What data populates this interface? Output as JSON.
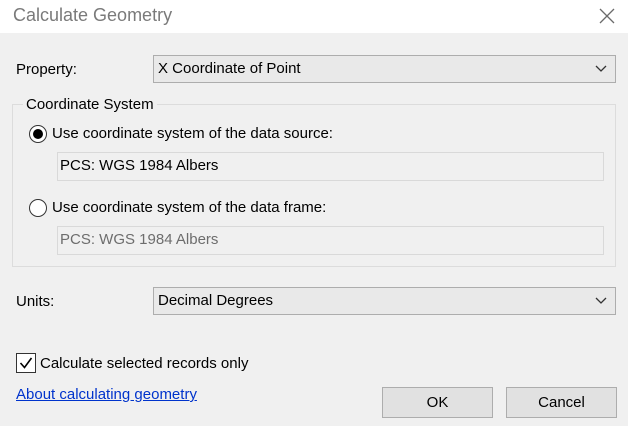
{
  "window": {
    "title": "Calculate Geometry"
  },
  "property": {
    "label": "Property:",
    "value": "X Coordinate of Point"
  },
  "coordinate_system": {
    "group_label": "Coordinate System",
    "option_source": {
      "label": "Use coordinate system of the data source:",
      "selected": true,
      "value": "PCS: WGS 1984 Albers"
    },
    "option_frame": {
      "label": "Use coordinate system of the data frame:",
      "selected": false,
      "value": "PCS: WGS 1984 Albers"
    }
  },
  "units": {
    "label": "Units:",
    "value": "Decimal Degrees"
  },
  "selected_only": {
    "label": "Calculate selected records only",
    "checked": true
  },
  "help_link": "About calculating geometry",
  "buttons": {
    "ok": "OK",
    "cancel": "Cancel"
  },
  "colors": {
    "link": "#0033cc",
    "dialog_bg": "#f0f0f0",
    "titlebar_bg": "#ffffff"
  }
}
